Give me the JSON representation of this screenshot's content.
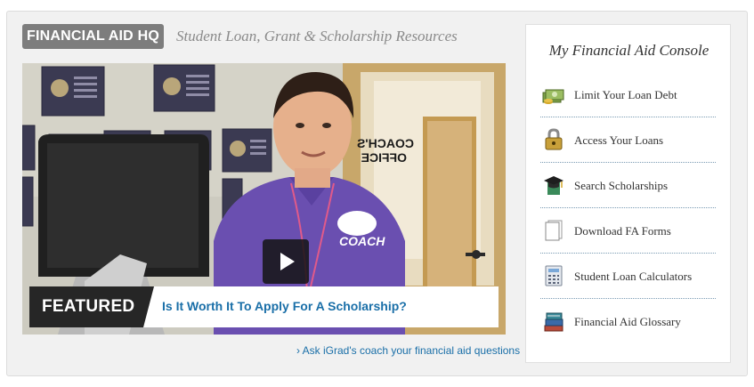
{
  "header": {
    "badge": "FINANCIAL AID HQ",
    "tagline": "Student Loan, Grant & Scholarship Resources"
  },
  "video": {
    "featured_label": "FEATURED",
    "featured_title": "Is It Worth It To Apply For A Scholarship?",
    "door_sign_line1": "COACH'S",
    "door_sign_line2": "OFFICE",
    "shirt_text": "COACH"
  },
  "ask_link": "› Ask iGrad's coach your financial aid questions",
  "console": {
    "title": "My Financial Aid Console",
    "items": [
      {
        "label": "Limit Your Loan Debt",
        "icon": "money-icon"
      },
      {
        "label": "Access Your Loans",
        "icon": "lock-icon"
      },
      {
        "label": "Search Scholarships",
        "icon": "graduation-cap-icon"
      },
      {
        "label": "Download FA Forms",
        "icon": "document-icon"
      },
      {
        "label": "Student Loan Calculators",
        "icon": "calculator-icon"
      },
      {
        "label": "Financial Aid Glossary",
        "icon": "books-icon"
      }
    ]
  },
  "colors": {
    "link_blue": "#1a6fa8",
    "badge_gray": "#7d7d7d",
    "featured_dark": "#262626",
    "shirt_purple": "#6a4fb0"
  }
}
